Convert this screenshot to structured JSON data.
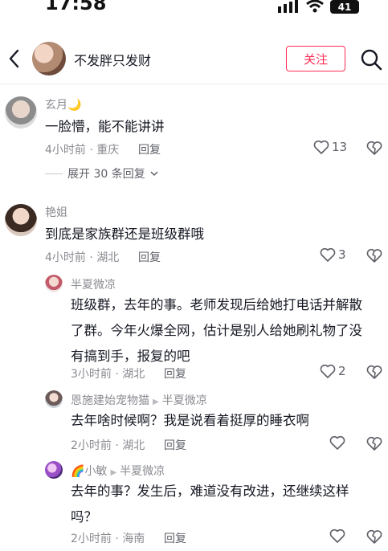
{
  "status": {
    "time": "17:58",
    "battery": "41"
  },
  "header": {
    "title": "不发胖只发财",
    "follow_label": "关注"
  },
  "comments": [
    {
      "name": "玄月",
      "name_emoji": "🌙",
      "text": "一脸懵，能不能讲讲",
      "meta": "4小时前 · 重庆",
      "reply_label": "回复",
      "likes": "13",
      "expand_label": "展开 30 条回复",
      "replies": []
    },
    {
      "name": "艳姐",
      "text": "到底是家族群还是班级群哦",
      "meta": "4小时前 · 湖北",
      "reply_label": "回复",
      "likes": "3",
      "replies": [
        {
          "name": "半夏微凉",
          "text_lines": [
            "班级群，去年的事。老师发现后给她打电话并解散",
            "了群。今年火爆全网，估计是别人给她刷礼物了没",
            "有搞到手，报复的吧"
          ],
          "meta": "3小时前 · 湖北",
          "reply_label": "回复",
          "likes": "2"
        },
        {
          "name": "恩施建始宠物猫",
          "reply_to": "半夏微凉",
          "text_lines": [
            "去年啥时候啊？我是说看着挺厚的睡衣啊"
          ],
          "meta": "2小时前 · 湖北",
          "reply_label": "回复",
          "likes": ""
        },
        {
          "name": "小敏",
          "name_emoji": "🌈",
          "reply_to": "半夏微凉",
          "text_lines": [
            "去年的事？发生后，难道没有改进，还继续这样",
            "吗？"
          ],
          "meta": "2小时前 · 海南",
          "reply_label": "回复",
          "likes": ""
        }
      ]
    }
  ]
}
